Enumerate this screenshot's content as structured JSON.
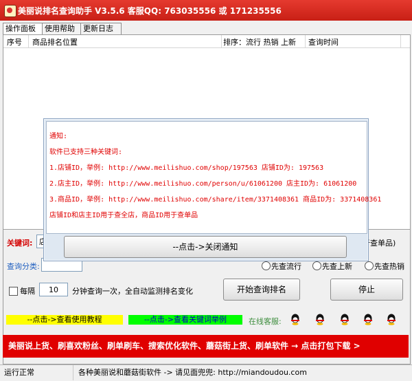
{
  "window": {
    "title": "美丽说排名查询助手 V3.5.6 客服QQ: 763035556 或 171235556"
  },
  "tabs": [
    {
      "label": "操作面板"
    },
    {
      "label": "使用帮助"
    },
    {
      "label": "更新日志"
    }
  ],
  "list": {
    "columns": [
      "序号",
      "商品排名位置",
      "排序：流行 热销 上新",
      "查询时间"
    ]
  },
  "form": {
    "keyword_label": "关键词:",
    "keyword_value": "店",
    "keyword_hint_right": "于查单品)",
    "category_label": "查询分类:",
    "radio_options": [
      {
        "label": "先查流行",
        "selected": false
      },
      {
        "label": "先查上新",
        "selected": false
      },
      {
        "label": "先查热销",
        "selected": false
      }
    ],
    "interval_checkbox_label": "每隔",
    "interval_checked": false,
    "interval_value": "10",
    "interval_suffix": "分钟查询一次，全自动监测排名变化",
    "start_button": "开始查询排名",
    "stop_button": "停止"
  },
  "links": {
    "tutorial": "--点击->查看使用教程",
    "keyword_examples": "--点击->查看关键词举例",
    "online_service_label": "在线客服:"
  },
  "qq_icons": [
    "qq-icon",
    "qq-icon",
    "qq-icon",
    "qq-icon",
    "qq-icon"
  ],
  "banner": {
    "text": "美丽说上货、刷喜欢粉丝、刷单刷车、搜索优化软件、蘑菇街上货、刷单软件 → 点击打包下载 >"
  },
  "status": {
    "state": "运行正常",
    "info": "各种美丽说和蘑菇街软件 -> 请见面兜兜: http://miandoudou.com"
  },
  "notice": {
    "lines": [
      "通知:",
      "软件已支持三种关键词:",
      "1.店铺ID，举例: http://www.meilishuo.com/shop/197563 店铺ID为: 197563",
      "2.店主ID，举例: http://www.meilishuo.com/person/u/61061200 店主ID为: 61061200",
      "3.商品ID，举例: http://www.meilishuo.com/share/item/3371408361 商品ID为: 3371408361",
      "店铺ID和店主ID用于查全店，商品ID用于查单品"
    ],
    "close_button": "--点击->关闭通知"
  },
  "colors": {
    "title_bar": "#d8281d",
    "banner": "#e00000",
    "notice_text": "#e00000",
    "link_yellow": "#ffff00",
    "link_green": "#00ff00"
  }
}
